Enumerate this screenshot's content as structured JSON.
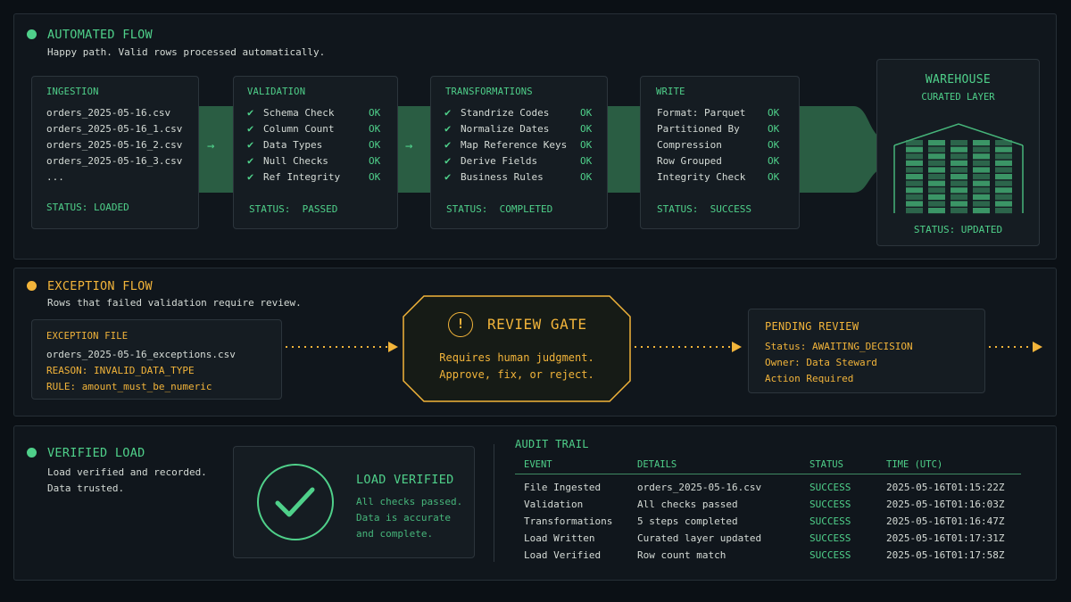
{
  "colors": {
    "green": "#4fd08a",
    "orange": "#f2b43a",
    "bg": "#0b1015",
    "panel": "#10161c"
  },
  "automated": {
    "title": "AUTOMATED FLOW",
    "subtitle": "Happy path. Valid rows processed automatically.",
    "ingestion": {
      "title": "INGESTION",
      "files": [
        "orders_2025-05-16.csv",
        "orders_2025-05-16_1.csv",
        "orders_2025-05-16_2.csv",
        "orders_2025-05-16_3.csv",
        "..."
      ],
      "status": "STATUS: LOADED"
    },
    "validation": {
      "title": "VALIDATION",
      "checks": [
        {
          "label": "Schema Check",
          "result": "OK"
        },
        {
          "label": "Column Count",
          "result": "OK"
        },
        {
          "label": "Data Types",
          "result": "OK"
        },
        {
          "label": "Null Checks",
          "result": "OK"
        },
        {
          "label": "Ref Integrity",
          "result": "OK"
        }
      ],
      "status": "STATUS:  PASSED"
    },
    "transformations": {
      "title": "TRANSFORMATIONS",
      "checks": [
        {
          "label": "Standrize Codes",
          "result": "OK"
        },
        {
          "label": "Normalize Dates",
          "result": "OK"
        },
        {
          "label": "Map Reference Keys",
          "result": "OK"
        },
        {
          "label": "Derive Fields",
          "result": "OK"
        },
        {
          "label": "Business Rules",
          "result": "OK"
        }
      ],
      "status": "STATUS:  COMPLETED"
    },
    "write": {
      "title": "WRITE",
      "items": [
        {
          "label": "Format: Parquet",
          "result": "OK"
        },
        {
          "label": "Partitioned By",
          "result": "OK"
        },
        {
          "label": "Compression",
          "result": "OK"
        },
        {
          "label": "Row Grouped",
          "result": "OK"
        },
        {
          "label": "Integrity Check",
          "result": "OK"
        }
      ],
      "status": "STATUS:  SUCCESS"
    },
    "warehouse": {
      "title": "WAREHOUSE",
      "subtitle": "CURATED LAYER",
      "status": "STATUS: UPDATED"
    }
  },
  "exception": {
    "title": "EXCEPTION FLOW",
    "subtitle": "Rows that failed validation require review.",
    "file": {
      "title": "EXCEPTION FILE",
      "name": "orders_2025-05-16_exceptions.csv",
      "reason": "REASON: INVALID_DATA_TYPE",
      "rule_label": "RULE: ",
      "rule_value": "amount_must_be_numeric"
    },
    "gate": {
      "title": "REVIEW GATE",
      "line1": "Requires human judgment.",
      "line2": "Approve, fix, or reject."
    },
    "pending": {
      "title": "PENDING REVIEW",
      "status": "Status: AWAITING_DECISION",
      "owner": "Owner: Data Steward",
      "action": "Action Required"
    }
  },
  "verified": {
    "title": "VERIFIED LOAD",
    "line1": "Load verified and recorded.",
    "line2": "Data trusted.",
    "card": {
      "title": "LOAD VERIFIED",
      "line1": "All checks passed.",
      "line2": "Data is accurate",
      "line3": "and complete."
    }
  },
  "audit": {
    "title": "AUDIT TRAIL",
    "headers": [
      "EVENT",
      "DETAILS",
      "STATUS",
      "TIME (UTC)"
    ],
    "rows": [
      [
        "File Ingested",
        "orders_2025-05-16.csv",
        "SUCCESS",
        "2025-05-16T01:15:22Z"
      ],
      [
        "Validation",
        "All checks passed",
        "SUCCESS",
        "2025-05-16T01:16:03Z"
      ],
      [
        "Transformations",
        "5 steps completed",
        "SUCCESS",
        "2025-05-16T01:16:47Z"
      ],
      [
        "Load Written",
        "Curated layer updated",
        "SUCCESS",
        "2025-05-16T01:17:31Z"
      ],
      [
        "Load Verified",
        "Row count match",
        "SUCCESS",
        "2025-05-16T01:17:58Z"
      ]
    ]
  }
}
